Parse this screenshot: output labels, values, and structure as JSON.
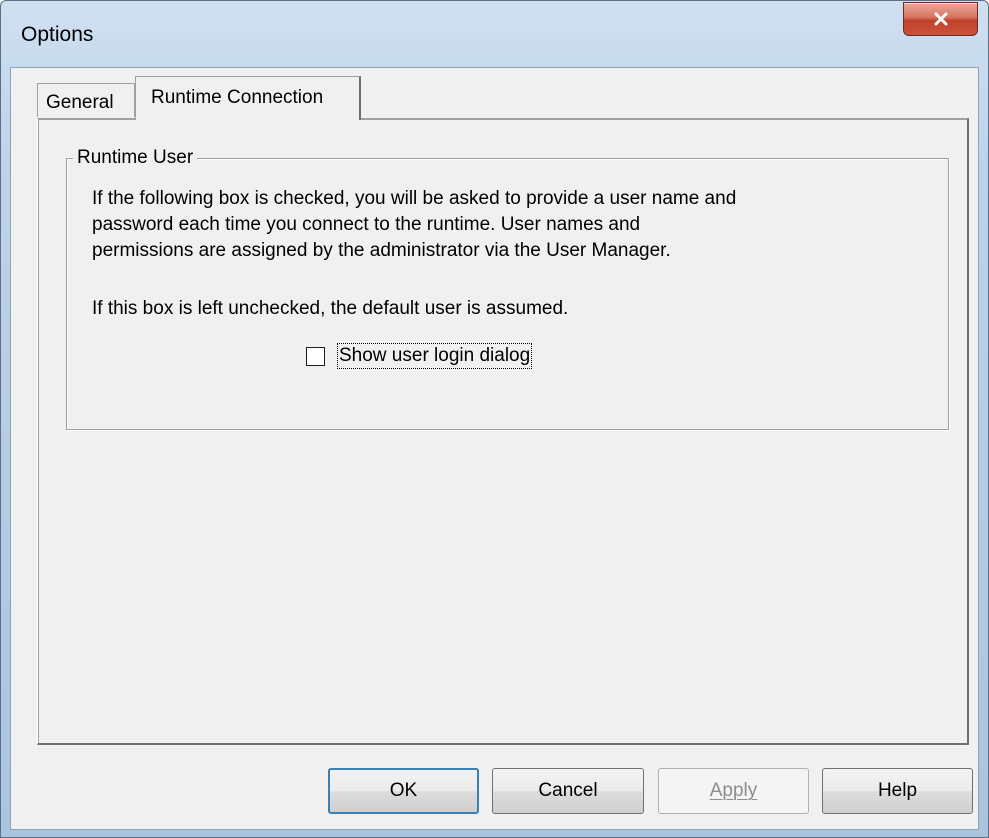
{
  "window": {
    "title": "Options"
  },
  "tabs": [
    {
      "label": "General",
      "active": false
    },
    {
      "label": "Runtime Connection",
      "active": true
    }
  ],
  "group": {
    "label": "Runtime User",
    "paragraph1": "If the following box is checked, you will be asked to provide a user name and\npassword each time you connect to the runtime.  User names and\npermissions are assigned by the administrator via the User Manager.",
    "paragraph2": "If this box is left unchecked, the default user is assumed.",
    "checkbox": {
      "label": "Show user login dialog",
      "checked": false
    }
  },
  "buttons": {
    "ok": "OK",
    "cancel": "Cancel",
    "apply": "Apply",
    "help": "Help"
  },
  "colors": {
    "dialog_background": "#f0f0f0",
    "close_button": "#c9533b",
    "default_button_border": "#3c7fb1",
    "disabled_text": "#8d8d8d"
  }
}
